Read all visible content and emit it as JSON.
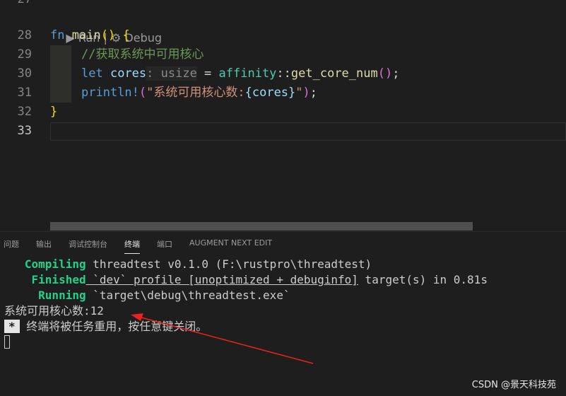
{
  "editor": {
    "codelens": {
      "run": "▶ Run",
      "sep": " | ",
      "debug": "⚙ Debug"
    },
    "lines": [
      {
        "num": "27"
      },
      {
        "num": "28",
        "tokens": {
          "t1": "fn",
          "t2": " ",
          "t3": "main",
          "t4": "()",
          "t5": " ",
          "t6": "{"
        }
      },
      {
        "num": "29",
        "tokens": {
          "t1": "//获取系统中可用核心"
        }
      },
      {
        "num": "30",
        "tokens": {
          "t1": "let",
          "t2": " ",
          "t3": "cores",
          "t4": ": usize",
          "t5": " = ",
          "t6": "affinity",
          "t7": "::",
          "t8": "get_core_num",
          "t9": "()",
          "t10": ";"
        }
      },
      {
        "num": "31",
        "tokens": {
          "t1": "println!",
          "t2": "(",
          "t3": "\"系统可用核心数:",
          "t4": "{cores}",
          "t5": "\"",
          "t6": ")",
          "t7": ";"
        }
      },
      {
        "num": "32",
        "tokens": {
          "t1": "}"
        }
      },
      {
        "num": "33"
      }
    ]
  },
  "panel": {
    "tabs": [
      "问题",
      "输出",
      "调试控制台",
      "终端",
      "端口",
      "AUGMENT NEXT EDIT"
    ],
    "active_tab": "终端"
  },
  "terminal": {
    "l1": {
      "status": "   Compiling",
      "text": " threadtest v0.1.0 (F:\\rustpro\\threadtest)"
    },
    "l2": {
      "status": "    Finished",
      "pre": " `dev` profile ",
      "und": "[unoptimized + debuginfo]",
      "post": " target(s) in 0.81s"
    },
    "l3": {
      "status": "     Running",
      "text": " `target\\debug\\threadtest.exe`"
    },
    "l4": {
      "text": "系统可用核心数:12"
    },
    "l5": {
      "star": "*",
      "text": " 终端将被任务重用，按任意键关闭。"
    }
  },
  "watermark": "CSDN @景天科技苑",
  "colors": {
    "accent_arrow": "#e8231c",
    "terminal_green": "#23d18b"
  }
}
